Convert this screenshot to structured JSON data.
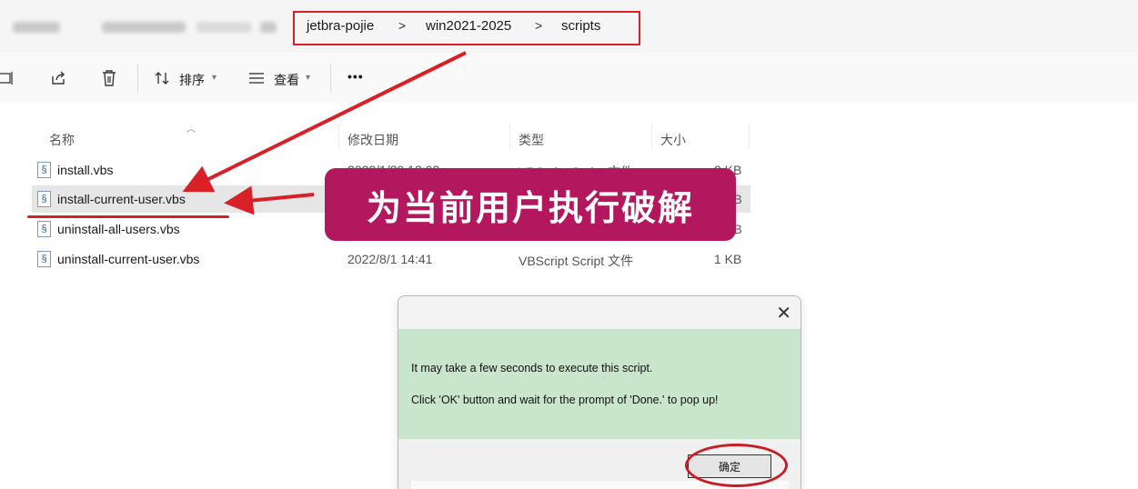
{
  "breadcrumb": {
    "items": [
      "jetbra-pojie",
      "win2021-2025",
      "scripts"
    ],
    "separator": ">"
  },
  "toolbar": {
    "sort_label": "排序",
    "view_label": "查看",
    "more_label": "•••"
  },
  "list": {
    "headers": {
      "name": "名称",
      "modified": "修改日期",
      "type": "类型",
      "size": "大小"
    },
    "rows": [
      {
        "name": "install.vbs",
        "modified": "2022/1/29 13:02",
        "type": "VBScript Script 文件",
        "size": "2 KB"
      },
      {
        "name": "install-current-user.vbs",
        "modified": "",
        "type": "",
        "size": "KB"
      },
      {
        "name": "uninstall-all-users.vbs",
        "modified": "",
        "type": "",
        "size": "KB"
      },
      {
        "name": "uninstall-current-user.vbs",
        "modified": "2022/8/1 14:41",
        "type": "VBScript Script 文件",
        "size": "1 KB"
      }
    ]
  },
  "annotation": {
    "callout_text": "为当前用户执行破解",
    "accent_color": "#b3185f",
    "marker_color": "#d92027"
  },
  "dialog": {
    "close_glyph": "✕",
    "message_line1": "It may take a few seconds to execute this script.",
    "message_line2": "Click 'OK' button and wait for the prompt of 'Done.' to pop up!",
    "ok_label": "确定",
    "body_color": "#c9e6cd"
  }
}
